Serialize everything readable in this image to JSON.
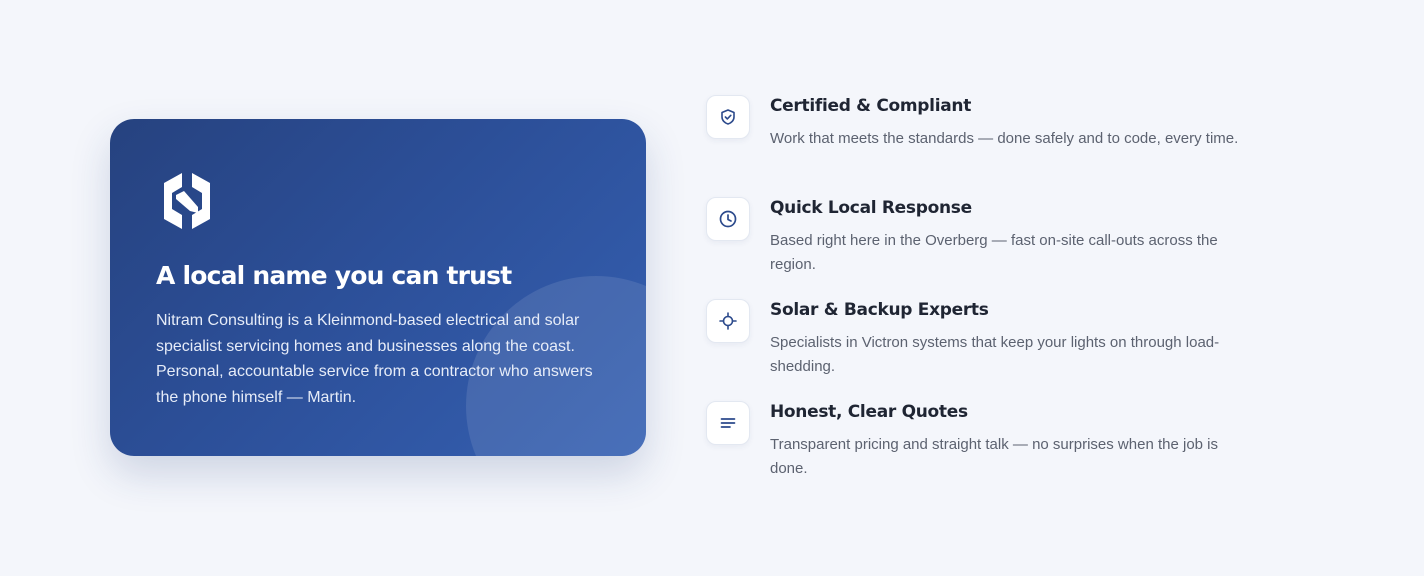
{
  "hero": {
    "logo_icon": "brand-logo-icon",
    "title": "A local name you can trust",
    "body": "Nitram Consulting is a Kleinmond-based electrical and solar specialist servicing homes and businesses along the coast. Personal, accountable service from a contractor who answers the phone himself — Martin.",
    "gradient_start": "#26427f",
    "gradient_end": "#3560b2"
  },
  "features": [
    {
      "icon": "shield-check-icon",
      "title": "Certified & Compliant",
      "description": "Work that meets the standards — done safely and to code, every time."
    },
    {
      "icon": "clock-icon",
      "title": "Quick Local Response",
      "description": "Based right here in the Overberg — fast on-site call-outs across the region."
    },
    {
      "icon": "crosshair-icon",
      "title": "Solar & Backup Experts",
      "description": "Specialists in Victron systems that keep your lights on through load-shedding."
    },
    {
      "icon": "lines-icon",
      "title": "Honest, Clear Quotes",
      "description": "Transparent pricing and straight talk — no surprises when the job is done."
    }
  ],
  "colors": {
    "accent": "#2c4f98",
    "icon_color": "#2c4a8c",
    "background": "#f4f6fb"
  }
}
